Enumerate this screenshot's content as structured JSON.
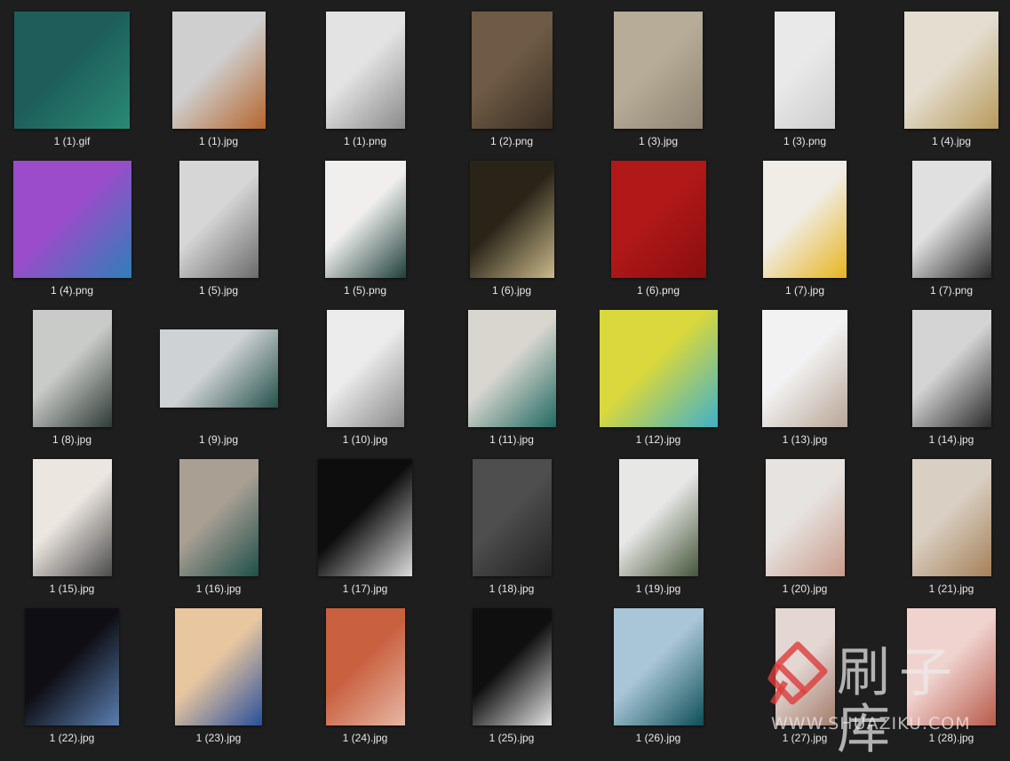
{
  "files": [
    {
      "name": "1 (1).gif",
      "w": 130,
      "h": 132,
      "c1": "#1d5d5a",
      "c2": "#2a8a74"
    },
    {
      "name": "1 (1).jpg",
      "w": 105,
      "h": 132,
      "c1": "#cfcfcf",
      "c2": "#b5652b"
    },
    {
      "name": "1 (1).png",
      "w": 89,
      "h": 132,
      "c1": "#e3e3e3",
      "c2": "#8a8a8a"
    },
    {
      "name": "1 (2).png",
      "w": 91,
      "h": 132,
      "c1": "#6e5a45",
      "c2": "#3b2f24"
    },
    {
      "name": "1 (3).jpg",
      "w": 100,
      "h": 132,
      "c1": "#b7ac97",
      "c2": "#8f8472"
    },
    {
      "name": "1 (3).png",
      "w": 68,
      "h": 132,
      "c1": "#e9e9e9",
      "c2": "#cdcdcd"
    },
    {
      "name": "1 (4).jpg",
      "w": 106,
      "h": 132,
      "c1": "#e4ddd0",
      "c2": "#b89a5a"
    },
    {
      "name": "1 (4).png",
      "w": 133,
      "h": 132,
      "c1": "#9b4cc9",
      "c2": "#2f7fb8"
    },
    {
      "name": "1 (5).jpg",
      "w": 89,
      "h": 132,
      "c1": "#d6d6d6",
      "c2": "#6a6a6a"
    },
    {
      "name": "1 (5).png",
      "w": 91,
      "h": 132,
      "c1": "#f0efed",
      "c2": "#1e3f3a"
    },
    {
      "name": "1 (6).jpg",
      "w": 95,
      "h": 132,
      "c1": "#2a2418",
      "c2": "#c9b98a"
    },
    {
      "name": "1 (6).png",
      "w": 107,
      "h": 132,
      "c1": "#b11818",
      "c2": "#8a0e0e"
    },
    {
      "name": "1 (7).jpg",
      "w": 94,
      "h": 132,
      "c1": "#f0ede6",
      "c2": "#e8b41c"
    },
    {
      "name": "1 (7).png",
      "w": 89,
      "h": 132,
      "c1": "#e0e0e0",
      "c2": "#2b2b2b"
    },
    {
      "name": "1 (8).jpg",
      "w": 89,
      "h": 132,
      "c1": "#c9cbc8",
      "c2": "#2e3a35"
    },
    {
      "name": "1 (9).jpg",
      "w": 133,
      "h": 88,
      "c1": "#cfd2d4",
      "c2": "#25514b"
    },
    {
      "name": "1 (10).jpg",
      "w": 87,
      "h": 132,
      "c1": "#ececec",
      "c2": "#8a8a8a"
    },
    {
      "name": "1 (11).jpg",
      "w": 99,
      "h": 132,
      "c1": "#d9d6d0",
      "c2": "#1f6a61"
    },
    {
      "name": "1 (12).jpg",
      "w": 133,
      "h": 132,
      "c1": "#d9d83c",
      "c2": "#3fb1c9"
    },
    {
      "name": "1 (13).jpg",
      "w": 96,
      "h": 132,
      "c1": "#f2f2f2",
      "c2": "#b8a596"
    },
    {
      "name": "1 (14).jpg",
      "w": 89,
      "h": 132,
      "c1": "#d4d4d4",
      "c2": "#2a2a2a"
    },
    {
      "name": "1 (15).jpg",
      "w": 89,
      "h": 132,
      "c1": "#ebe6e0",
      "c2": "#4b4b4b"
    },
    {
      "name": "1 (16).jpg",
      "w": 89,
      "h": 132,
      "c1": "#a99f93",
      "c2": "#1d4f4a"
    },
    {
      "name": "1 (17).jpg",
      "w": 106,
      "h": 132,
      "c1": "#0d0d0d",
      "c2": "#dcdcdc"
    },
    {
      "name": "1 (18).jpg",
      "w": 89,
      "h": 132,
      "c1": "#4e4e4e",
      "c2": "#222222"
    },
    {
      "name": "1 (19).jpg",
      "w": 89,
      "h": 132,
      "c1": "#e7e7e5",
      "c2": "#44553a"
    },
    {
      "name": "1 (20).jpg",
      "w": 89,
      "h": 132,
      "c1": "#e6e3e0",
      "c2": "#c99b8a"
    },
    {
      "name": "1 (21).jpg",
      "w": 89,
      "h": 132,
      "c1": "#d9cfc2",
      "c2": "#a68059"
    },
    {
      "name": "1 (22).jpg",
      "w": 106,
      "h": 132,
      "c1": "#0e0e14",
      "c2": "#5a7fb2"
    },
    {
      "name": "1 (23).jpg",
      "w": 98,
      "h": 132,
      "c1": "#e8c7a0",
      "c2": "#2a4f9a"
    },
    {
      "name": "1 (24).jpg",
      "w": 89,
      "h": 132,
      "c1": "#c9603f",
      "c2": "#e6b7a5"
    },
    {
      "name": "1 (25).jpg",
      "w": 89,
      "h": 132,
      "c1": "#0f0f0f",
      "c2": "#e2e2e2"
    },
    {
      "name": "1 (26).jpg",
      "w": 101,
      "h": 132,
      "c1": "#a9c6d8",
      "c2": "#0d4f56"
    },
    {
      "name": "1 (27).jpg",
      "w": 67,
      "h": 132,
      "c1": "#e4d7d3",
      "c2": "#a27c6a"
    },
    {
      "name": "1 (28).jpg",
      "w": 100,
      "h": 132,
      "c1": "#f0d3cf",
      "c2": "#b85a4a"
    }
  ],
  "watermark": {
    "text": "刷子库",
    "url": "WWW.SHUAZIKU.COM",
    "color": "#e0e0e0"
  }
}
